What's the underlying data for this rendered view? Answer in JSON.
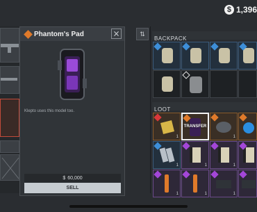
{
  "currency": {
    "amount": "1,396"
  },
  "item_panel": {
    "title": "Phantom's Pad",
    "description": "Klepto uses this model too.",
    "price": "60,000",
    "sell_label": "SELL"
  },
  "backpack": {
    "title": "BACKPACK"
  },
  "loot": {
    "title": "LOOT",
    "transfer_label": "TRANSFER"
  },
  "quantities": {
    "one": "1"
  },
  "colors": {
    "rare_blue": "#3d8ed8",
    "legendary_orange": "#e07a2a",
    "epic_purple": "#a346d8"
  }
}
